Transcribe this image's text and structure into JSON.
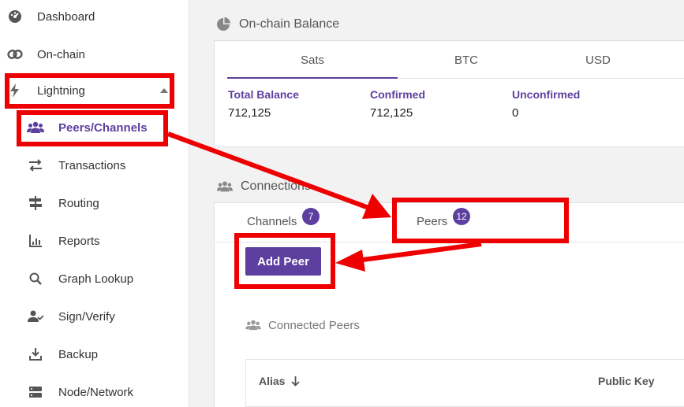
{
  "sidebar": {
    "items": [
      {
        "label": "Dashboard",
        "icon": "speedometer-icon"
      },
      {
        "label": "On-chain",
        "icon": "link-icon"
      },
      {
        "label": "Lightning",
        "icon": "bolt-icon"
      },
      {
        "label": "Peers/Channels",
        "icon": "users-icon"
      },
      {
        "label": "Transactions",
        "icon": "exchange-icon"
      },
      {
        "label": "Routing",
        "icon": "signpost-icon"
      },
      {
        "label": "Reports",
        "icon": "bar-chart-icon"
      },
      {
        "label": "Graph Lookup",
        "icon": "search-icon"
      },
      {
        "label": "Sign/Verify",
        "icon": "user-check-icon"
      },
      {
        "label": "Backup",
        "icon": "download-icon"
      },
      {
        "label": "Node/Network",
        "icon": "server-icon"
      }
    ]
  },
  "onchain": {
    "title": "On-chain Balance",
    "tabs": [
      "Sats",
      "BTC",
      "USD"
    ],
    "balances": [
      {
        "label": "Total Balance",
        "value": "712,125"
      },
      {
        "label": "Confirmed",
        "value": "712,125"
      },
      {
        "label": "Unconfirmed",
        "value": "0"
      }
    ]
  },
  "connections": {
    "title": "Connections",
    "tabs": [
      {
        "label": "Channels",
        "count": "7"
      },
      {
        "label": "Peers",
        "count": "12"
      }
    ],
    "add_peer_label": "Add Peer",
    "connected_peers_title": "Connected Peers",
    "table_headers": [
      "Alias",
      "Public Key"
    ]
  },
  "colors": {
    "accent": "#5c3f9e",
    "annotation": "#ee0000"
  }
}
